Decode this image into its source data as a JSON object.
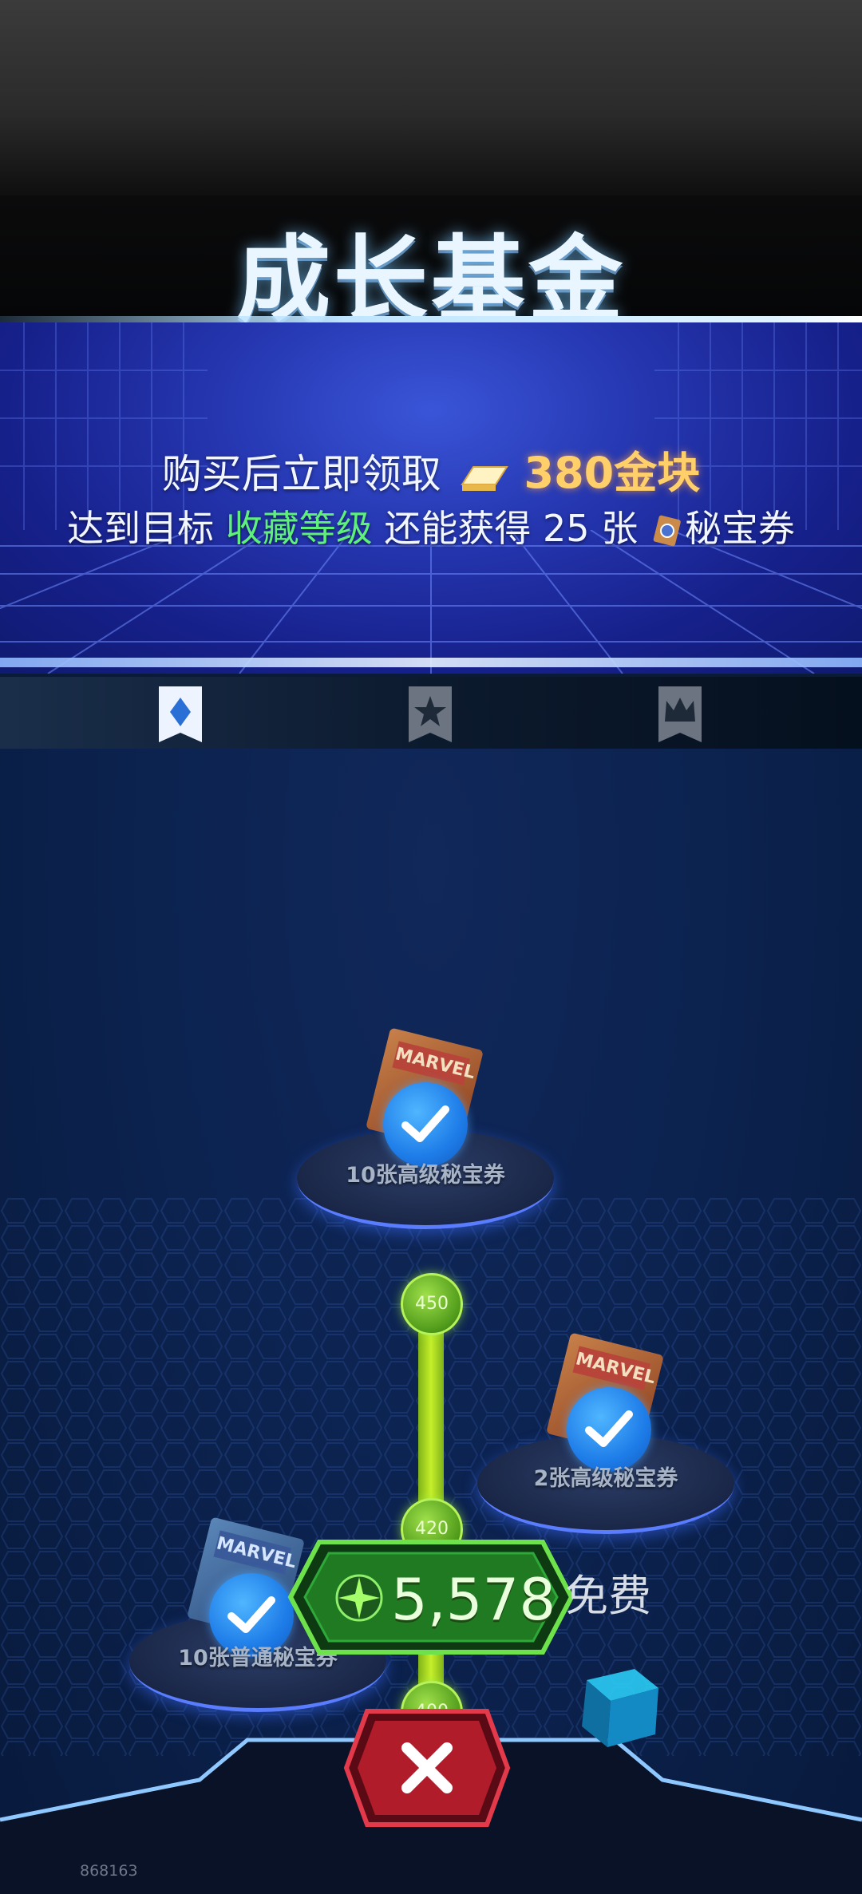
{
  "header": {
    "title": "成长基金"
  },
  "banner": {
    "line1_prefix": "购买后立即领取",
    "line1_gold": "380金块",
    "line2_prefix": "达到目标 ",
    "line2_highlight": "收藏等级",
    "line2_middle": " 还能获得 25 张",
    "line2_suffix": "秘宝券"
  },
  "tabs": [
    {
      "icon": "diamond-icon",
      "active": true
    },
    {
      "icon": "star-icon",
      "active": false
    },
    {
      "icon": "crown-icon",
      "active": false
    }
  ],
  "rewards": [
    {
      "label": "10张高级秘宝券",
      "card_brand": "MARVEL",
      "claimed": true
    },
    {
      "label": "2张高级秘宝券",
      "card_brand": "MARVEL",
      "claimed": true
    },
    {
      "label": "10张普通秘宝券",
      "card_brand": "MARVEL",
      "claimed": true
    }
  ],
  "track": {
    "nodes": [
      "450",
      "420",
      "400"
    ]
  },
  "currency": {
    "value": "5,578",
    "icon": "sparkle-icon"
  },
  "free_label": "免费",
  "footer": {
    "id": "868163"
  },
  "colors": {
    "highlight_green": "#5ef07a",
    "gold": "#ffcf6a",
    "check_blue": "#1e7ce8",
    "close_red": "#c42432"
  }
}
